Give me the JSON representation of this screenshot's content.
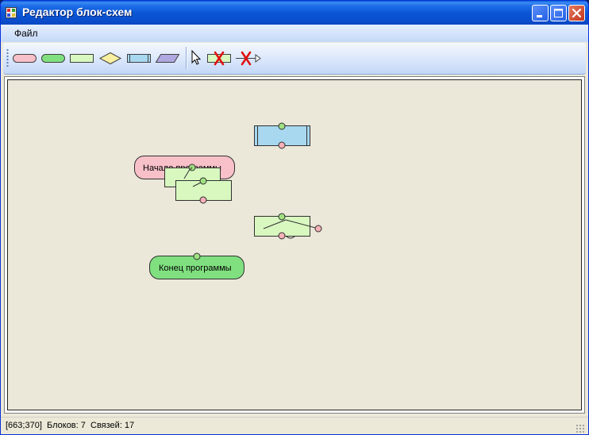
{
  "window": {
    "title": "Редактор блок-схем"
  },
  "menu": {
    "items": [
      "Файл"
    ]
  },
  "toolbar": {
    "tools": [
      {
        "name": "start-block",
        "color": "#f8c0c8"
      },
      {
        "name": "end-block",
        "color": "#80e080"
      },
      {
        "name": "action-block",
        "color": "#d8f8c0"
      },
      {
        "name": "condition-block",
        "color": "#f8f0a0"
      },
      {
        "name": "subroutine-block",
        "color": "#a8d8f0"
      },
      {
        "name": "io-block",
        "color": "#b0a8e0"
      },
      {
        "name": "select-tool"
      },
      {
        "name": "delete-block-tool"
      },
      {
        "name": "delete-link-tool"
      }
    ]
  },
  "diagram": {
    "blocks": [
      {
        "id": "start",
        "type": "terminator-start",
        "label": "Начало программы",
        "color": "#f8c0c8"
      },
      {
        "id": "action1",
        "type": "action",
        "label": "",
        "color": "#d8f8c0"
      },
      {
        "id": "action2",
        "type": "action",
        "label": "",
        "color": "#d8f8c0"
      },
      {
        "id": "subroutine",
        "type": "subroutine",
        "label": "",
        "color": "#a8d8f0"
      },
      {
        "id": "action3",
        "type": "action",
        "label": "",
        "color": "#d8f8c0"
      },
      {
        "id": "end",
        "type": "terminator-end",
        "label": "Конец программы",
        "color": "#80e080"
      }
    ],
    "connector_in_color": "#a0e080",
    "connector_out_color": "#f8b0b8"
  },
  "status": {
    "cursor": "[663;370]",
    "blocks": "Блоков: 7",
    "links": "Связей: 17"
  }
}
